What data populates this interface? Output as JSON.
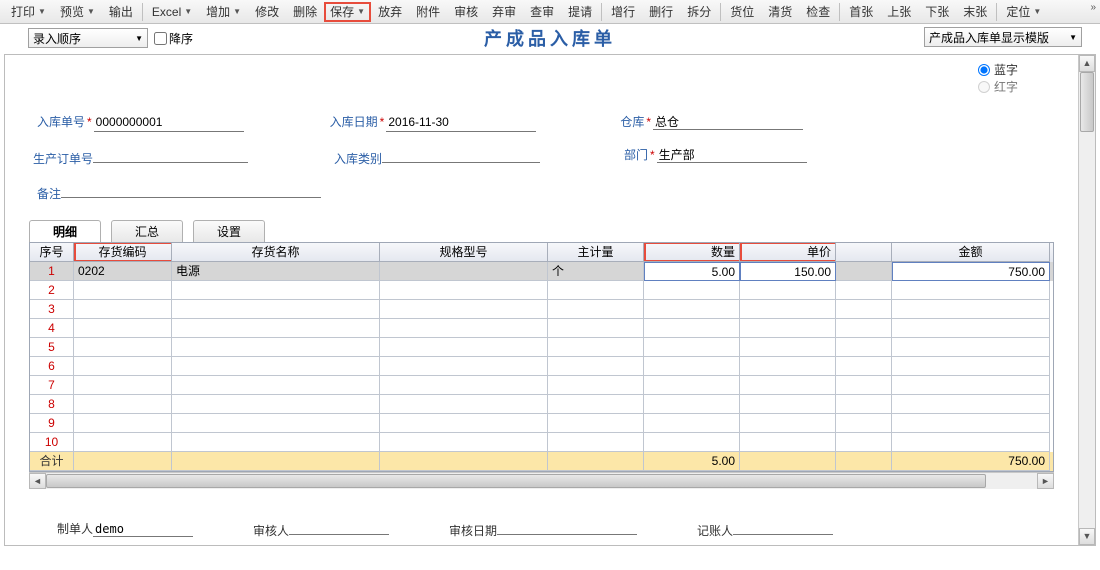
{
  "toolbar": {
    "print": "打印",
    "preview": "预览",
    "output": "输出",
    "excel": "Excel",
    "add": "增加",
    "edit": "修改",
    "delete": "删除",
    "save": "保存",
    "giveup": "放弃",
    "attach": "附件",
    "audit": "审核",
    "unaudit": "弃审",
    "query": "查审",
    "request": "提请",
    "addrow": "增行",
    "delrow": "删行",
    "split": "拆分",
    "bin": "货位",
    "clear": "清货",
    "check": "检查",
    "first": "首张",
    "prev": "上张",
    "next": "下张",
    "last": "末张",
    "locate": "定位"
  },
  "subbar": {
    "order_seq": "录入顺序",
    "desc_label": "降序",
    "template": "产成品入库单显示模版"
  },
  "title": "产成品入库单",
  "radios": {
    "blue": "蓝字",
    "red": "红字"
  },
  "form": {
    "rkdh_lbl": "入库单号",
    "rkdh_val": "0000000001",
    "rkrq_lbl": "入库日期",
    "rkrq_val": "2016-11-30",
    "ck_lbl": "仓库",
    "ck_val": "总仓",
    "scdd_lbl": "生产订单号",
    "scdd_val": "",
    "rklb_lbl": "入库类别",
    "rklb_val": "",
    "bm_lbl": "部门",
    "bm_val": "生产部",
    "bz_lbl": "备注",
    "bz_val": ""
  },
  "tabs": {
    "detail": "明细",
    "summary": "汇总",
    "settings": "设置"
  },
  "grid": {
    "headers": {
      "idx": "序号",
      "code": "存货编码",
      "name": "存货名称",
      "spec": "规格型号",
      "unit": "主计量",
      "qty": "数量",
      "price": "单价",
      "amt": "金额"
    },
    "rows": [
      {
        "idx": "1",
        "code": "0202",
        "name": "电源",
        "spec": "",
        "unit": "个",
        "qty": "5.00",
        "price": "150.00",
        "amt": "750.00"
      },
      {
        "idx": "2"
      },
      {
        "idx": "3"
      },
      {
        "idx": "4"
      },
      {
        "idx": "5"
      },
      {
        "idx": "6"
      },
      {
        "idx": "7"
      },
      {
        "idx": "8"
      },
      {
        "idx": "9"
      },
      {
        "idx": "10"
      }
    ],
    "total_lbl": "合计",
    "total_qty": "5.00",
    "total_amt": "750.00"
  },
  "footer": {
    "maker_lbl": "制单人",
    "maker_val": "demo",
    "auditor_lbl": "审核人",
    "auditor_val": "",
    "auditdate_lbl": "审核日期",
    "auditdate_val": "",
    "bookkeeper_lbl": "记账人",
    "bookkeeper_val": ""
  }
}
